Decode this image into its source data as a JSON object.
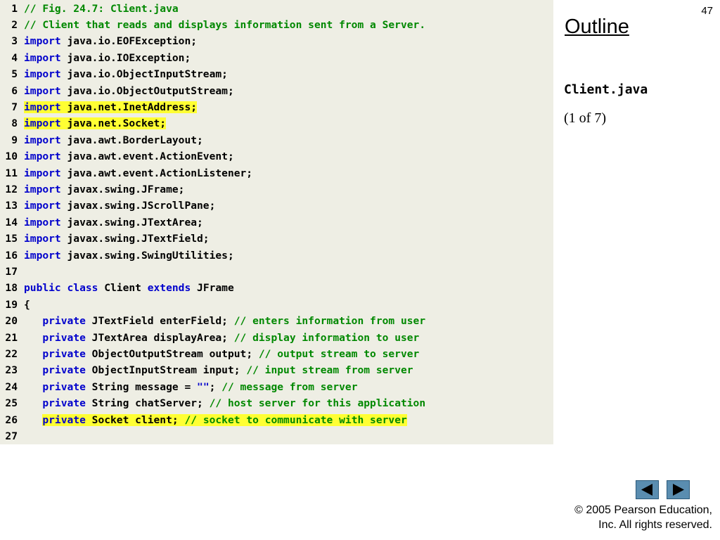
{
  "page_number": "47",
  "sidebar": {
    "outline_title": "Outline",
    "file_name": "Client.java",
    "part_label": "(1 of 7)"
  },
  "footer": {
    "copyright_line1": "© 2005 Pearson Education,",
    "copyright_line2": "Inc.  All rights reserved."
  },
  "navigation": {
    "prev_icon": "triangle-left-icon",
    "next_icon": "triangle-right-icon"
  },
  "colors": {
    "keyword": "#0000cc",
    "comment": "#008800",
    "highlight": "#ffff33",
    "code_background": "#eeeee4",
    "nav_button": "#5a8db0"
  },
  "code": {
    "lines": [
      {
        "num": "1",
        "segments": [
          {
            "t": "// Fig. 24.7: Client.java",
            "c": "cm"
          }
        ]
      },
      {
        "num": "2",
        "segments": [
          {
            "t": "// Client that reads and displays information sent from a Server.",
            "c": "cm"
          }
        ]
      },
      {
        "num": "3",
        "segments": [
          {
            "t": "import",
            "c": "kw"
          },
          {
            "t": " java.io.EOFException;",
            "c": ""
          }
        ]
      },
      {
        "num": "4",
        "segments": [
          {
            "t": "import",
            "c": "kw"
          },
          {
            "t": " java.io.IOException;",
            "c": ""
          }
        ]
      },
      {
        "num": "5",
        "segments": [
          {
            "t": "import",
            "c": "kw"
          },
          {
            "t": " java.io.ObjectInputStream;",
            "c": ""
          }
        ]
      },
      {
        "num": "6",
        "segments": [
          {
            "t": "import",
            "c": "kw"
          },
          {
            "t": " java.io.ObjectOutputStream;",
            "c": ""
          }
        ]
      },
      {
        "num": "7",
        "highlight": true,
        "segments": [
          {
            "t": "import",
            "c": "kw"
          },
          {
            "t": " java.net.InetAddress;",
            "c": ""
          }
        ]
      },
      {
        "num": "8",
        "highlight": true,
        "segments": [
          {
            "t": "import",
            "c": "kw"
          },
          {
            "t": " java.net.Socket;",
            "c": ""
          }
        ]
      },
      {
        "num": "9",
        "segments": [
          {
            "t": "import",
            "c": "kw"
          },
          {
            "t": " java.awt.BorderLayout;",
            "c": ""
          }
        ]
      },
      {
        "num": "10",
        "segments": [
          {
            "t": "import",
            "c": "kw"
          },
          {
            "t": " java.awt.event.ActionEvent;",
            "c": ""
          }
        ]
      },
      {
        "num": "11",
        "segments": [
          {
            "t": "import",
            "c": "kw"
          },
          {
            "t": " java.awt.event.ActionListener;",
            "c": ""
          }
        ]
      },
      {
        "num": "12",
        "segments": [
          {
            "t": "import",
            "c": "kw"
          },
          {
            "t": " javax.swing.JFrame;",
            "c": ""
          }
        ]
      },
      {
        "num": "13",
        "segments": [
          {
            "t": "import",
            "c": "kw"
          },
          {
            "t": " javax.swing.JScrollPane;",
            "c": ""
          }
        ]
      },
      {
        "num": "14",
        "segments": [
          {
            "t": "import",
            "c": "kw"
          },
          {
            "t": " javax.swing.JTextArea;",
            "c": ""
          }
        ]
      },
      {
        "num": "15",
        "segments": [
          {
            "t": "import",
            "c": "kw"
          },
          {
            "t": " javax.swing.JTextField;",
            "c": ""
          }
        ]
      },
      {
        "num": "16",
        "segments": [
          {
            "t": "import",
            "c": "kw"
          },
          {
            "t": " javax.swing.SwingUtilities;",
            "c": ""
          }
        ]
      },
      {
        "num": "17",
        "segments": []
      },
      {
        "num": "18",
        "segments": [
          {
            "t": "public class",
            "c": "kw"
          },
          {
            "t": " Client ",
            "c": ""
          },
          {
            "t": "extends",
            "c": "kw"
          },
          {
            "t": " JFrame",
            "c": ""
          }
        ]
      },
      {
        "num": "19",
        "segments": [
          {
            "t": "{",
            "c": ""
          }
        ]
      },
      {
        "num": "20",
        "segments": [
          {
            "t": "   ",
            "c": ""
          },
          {
            "t": "private",
            "c": "kw"
          },
          {
            "t": " JTextField enterField; ",
            "c": ""
          },
          {
            "t": "// enters information from user",
            "c": "cm"
          }
        ]
      },
      {
        "num": "21",
        "segments": [
          {
            "t": "   ",
            "c": ""
          },
          {
            "t": "private",
            "c": "kw"
          },
          {
            "t": " JTextArea displayArea; ",
            "c": ""
          },
          {
            "t": "// display information to user",
            "c": "cm"
          }
        ]
      },
      {
        "num": "22",
        "segments": [
          {
            "t": "   ",
            "c": ""
          },
          {
            "t": "private",
            "c": "kw"
          },
          {
            "t": " ObjectOutputStream output; ",
            "c": ""
          },
          {
            "t": "// output stream to server",
            "c": "cm"
          }
        ]
      },
      {
        "num": "23",
        "segments": [
          {
            "t": "   ",
            "c": ""
          },
          {
            "t": "private",
            "c": "kw"
          },
          {
            "t": " ObjectInputStream input; ",
            "c": ""
          },
          {
            "t": "// input stream from server",
            "c": "cm"
          }
        ]
      },
      {
        "num": "24",
        "segments": [
          {
            "t": "   ",
            "c": ""
          },
          {
            "t": "private",
            "c": "kw"
          },
          {
            "t": " String message = ",
            "c": ""
          },
          {
            "t": "\"\"",
            "c": "str"
          },
          {
            "t": "; ",
            "c": ""
          },
          {
            "t": "// message from server",
            "c": "cm"
          }
        ]
      },
      {
        "num": "25",
        "segments": [
          {
            "t": "   ",
            "c": ""
          },
          {
            "t": "private",
            "c": "kw"
          },
          {
            "t": " String chatServer; ",
            "c": ""
          },
          {
            "t": "// host server for this application",
            "c": "cm"
          }
        ]
      },
      {
        "num": "26",
        "highlight": true,
        "highlight_from": 1,
        "segments": [
          {
            "t": "   ",
            "c": ""
          },
          {
            "t": "private",
            "c": "kw"
          },
          {
            "t": " Socket client; ",
            "c": ""
          },
          {
            "t": "// socket to communicate with server",
            "c": "cm"
          }
        ]
      },
      {
        "num": "27",
        "segments": []
      }
    ]
  }
}
